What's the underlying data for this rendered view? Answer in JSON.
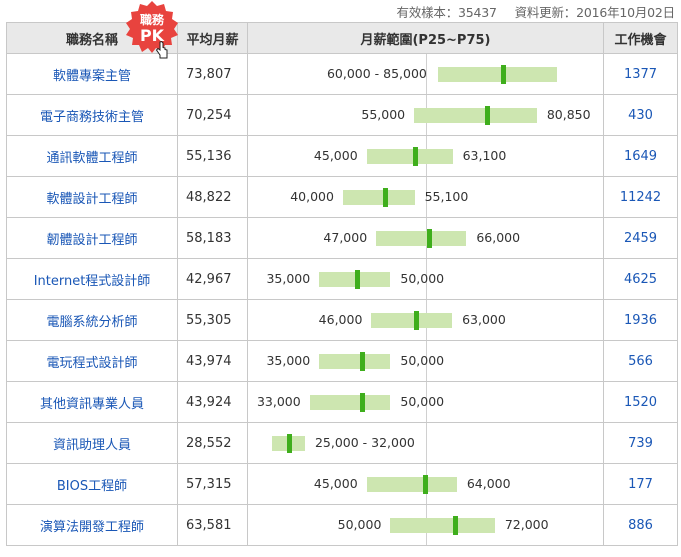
{
  "meta": {
    "sample_label": "有效樣本：35437",
    "update_label": "資料更新：2016年10月02日"
  },
  "headers": {
    "name": "職務名稱",
    "avg": "平均月薪",
    "range": "月薪範圍(P25~P75)",
    "jobs": "工作機會"
  },
  "pk_badge": {
    "line1": "職務",
    "line2": "PK",
    "color": "#e8433e"
  },
  "colors": {
    "link": "#1a57b6",
    "bar": "#cde6b0",
    "mark": "#3fae1c",
    "header_bg": "#e9e9e9"
  },
  "axis": {
    "min": 20000,
    "max": 95000
  },
  "rows": [
    {
      "name": "軟體專案主管",
      "avg": "73,807",
      "p25": 60000,
      "p75": 85000,
      "mean": 73807,
      "range_text": "60,000 - 85,000",
      "jobs": "1377"
    },
    {
      "name": "電子商務技術主管",
      "avg": "70,254",
      "p25": 55000,
      "p75": 80850,
      "mean": 70254,
      "left_text": "55,000",
      "right_text": "80,850",
      "jobs": "430"
    },
    {
      "name": "通訊軟體工程師",
      "avg": "55,136",
      "p25": 45000,
      "p75": 63100,
      "mean": 55136,
      "left_text": "45,000",
      "right_text": "63,100",
      "jobs": "1649"
    },
    {
      "name": "軟體設計工程師",
      "avg": "48,822",
      "p25": 40000,
      "p75": 55100,
      "mean": 48822,
      "left_text": "40,000",
      "right_text": "55,100",
      "jobs": "11242"
    },
    {
      "name": "韌體設計工程師",
      "avg": "58,183",
      "p25": 47000,
      "p75": 66000,
      "mean": 58183,
      "left_text": "47,000",
      "right_text": "66,000",
      "jobs": "2459"
    },
    {
      "name": "Internet程式設計師",
      "avg": "42,967",
      "p25": 35000,
      "p75": 50000,
      "mean": 42967,
      "left_text": "35,000",
      "right_text": "50,000",
      "jobs": "4625"
    },
    {
      "name": "電腦系統分析師",
      "avg": "55,305",
      "p25": 46000,
      "p75": 63000,
      "mean": 55305,
      "left_text": "46,000",
      "right_text": "63,000",
      "jobs": "1936"
    },
    {
      "name": "電玩程式設計師",
      "avg": "43,974",
      "p25": 35000,
      "p75": 50000,
      "mean": 43974,
      "left_text": "35,000",
      "right_text": "50,000",
      "jobs": "566"
    },
    {
      "name": "其他資訊專業人員",
      "avg": "43,924",
      "p25": 33000,
      "p75": 50000,
      "mean": 43924,
      "left_text": "33,000",
      "right_text": "50,000",
      "jobs": "1520"
    },
    {
      "name": "資訊助理人員",
      "avg": "28,552",
      "p25": 25000,
      "p75": 32000,
      "mean": 28552,
      "range_text": "25,000 - 32,000",
      "jobs": "739"
    },
    {
      "name": "BIOS工程師",
      "avg": "57,315",
      "p25": 45000,
      "p75": 64000,
      "mean": 57315,
      "left_text": "45,000",
      "right_text": "64,000",
      "jobs": "177"
    },
    {
      "name": "演算法開發工程師",
      "avg": "63,581",
      "p25": 50000,
      "p75": 72000,
      "mean": 63581,
      "left_text": "50,000",
      "right_text": "72,000",
      "jobs": "886"
    }
  ]
}
